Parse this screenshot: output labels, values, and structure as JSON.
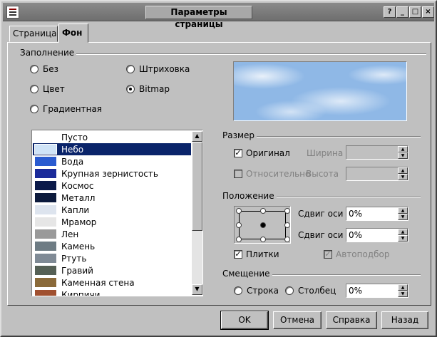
{
  "window": {
    "title": "Параметры страницы"
  },
  "titlebar_buttons": {
    "help": "?",
    "min": "_",
    "max": "□",
    "close": "×"
  },
  "tabs": [
    {
      "label": "Страница"
    },
    {
      "label": "Фон"
    }
  ],
  "fill": {
    "group_label": "Заполнение",
    "options": [
      {
        "label": "Без",
        "checked": false
      },
      {
        "label": "Цвет",
        "checked": false
      },
      {
        "label": "Градиентная",
        "checked": false
      },
      {
        "label": "Штриховка",
        "checked": false
      },
      {
        "label": "Bitmap",
        "checked": true
      }
    ]
  },
  "bitmaps": [
    {
      "label": "Пусто",
      "color": "#ffffff"
    },
    {
      "label": "Небо",
      "color": "#cfe3f7",
      "selected": true
    },
    {
      "label": "Вода",
      "color": "#2a5bd0"
    },
    {
      "label": "Крупная зернистость",
      "color": "#1b2b9a"
    },
    {
      "label": "Космос",
      "color": "#0b1a4a"
    },
    {
      "label": "Металл",
      "color": "#0c1a3c"
    },
    {
      "label": "Капли",
      "color": "#dde4ee"
    },
    {
      "label": "Мрамор",
      "color": "#e6e6e6"
    },
    {
      "label": "Лен",
      "color": "#9a9a9a"
    },
    {
      "label": "Камень",
      "color": "#6e7c84"
    },
    {
      "label": "Ртуть",
      "color": "#7f8a95"
    },
    {
      "label": "Гравий",
      "color": "#556055"
    },
    {
      "label": "Каменная стена",
      "color": "#8a6a3a"
    },
    {
      "label": "Кирпичи",
      "color": "#a05030"
    }
  ],
  "size": {
    "group_label": "Размер",
    "original_label": "Оригинал",
    "original_checked": true,
    "relative_label": "Относительно",
    "width_label": "Ширина",
    "height_label": "Высота"
  },
  "position": {
    "group_label": "Положение",
    "offset_x_label": "Сдвиг оси X",
    "offset_x_value": "0%",
    "offset_y_label": "Сдвиг оси Y",
    "offset_y_value": "0%",
    "tile_label": "Плитки",
    "tile_checked": true,
    "autofit_label": "Автоподбор"
  },
  "offset": {
    "group_label": "Смещение",
    "row_label": "Строка",
    "column_label": "Столбец",
    "value": "0%"
  },
  "buttons": {
    "ok": "OK",
    "cancel": "Отмена",
    "help": "Справка",
    "back": "Назад"
  }
}
